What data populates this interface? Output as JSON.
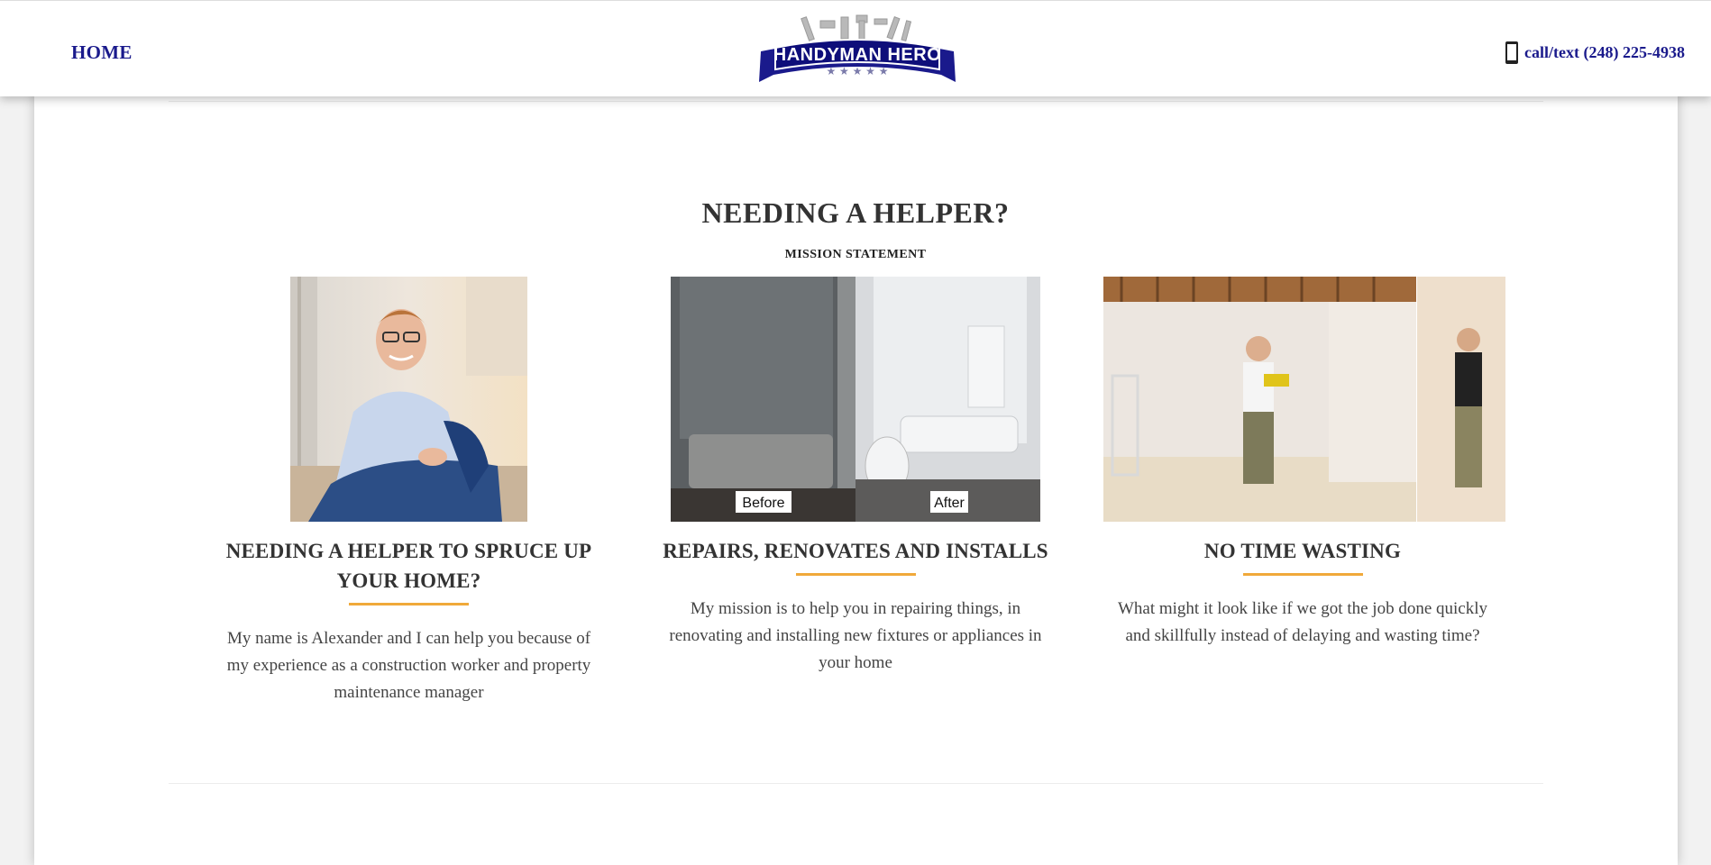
{
  "header": {
    "nav_home": "HOME",
    "phone": "call/text (248) 225-4938",
    "logo_text": "HANDYMAN HERO",
    "accent_color": "#1a1a8c"
  },
  "section": {
    "title": "NEEDING A HELPER?",
    "subtitle": "MISSION STATEMENT"
  },
  "cards": [
    {
      "heading": "NEEDING A HELPER TO SPRUCE UP YOUR HOME?",
      "text": "My name is Alexander and I can help you because of my experience as a construction worker and property maintenance manager"
    },
    {
      "heading": "REPAIRS, RENOVATES AND INSTALLS",
      "text": "My mission is to help you in repairing things, in renovating and installing new fixtures or appliances in your home",
      "photo_labels": [
        "Before",
        "After"
      ]
    },
    {
      "heading": "NO TIME WASTING",
      "text": "What might it look like if we got the job done quickly and skillfully instead of delaying and wasting time?"
    }
  ],
  "colors": {
    "heading_underline": "#f0a93a",
    "nav": "#1a1a8c"
  }
}
